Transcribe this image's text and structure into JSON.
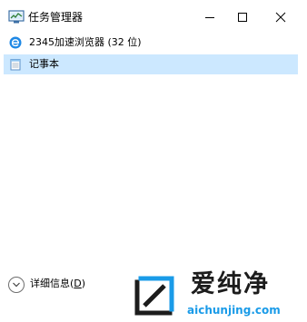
{
  "window": {
    "title": "任务管理器",
    "app_icon": "task-manager-icon"
  },
  "controls": {
    "minimize_icon": "minimize-icon",
    "maximize_icon": "maximize-icon",
    "close_icon": "close-icon"
  },
  "processes": [
    {
      "label": "2345加速浏览器 (32 位)",
      "icon": "browser-e-icon",
      "selected": false
    },
    {
      "label": "记事本",
      "icon": "notepad-icon",
      "selected": true
    }
  ],
  "footer": {
    "details_text": "详细信息(",
    "details_key": "D",
    "details_close": ")",
    "chevron_icon": "chevron-down-icon"
  },
  "watermark": {
    "text": "爱纯净",
    "url": "aichunjing.com"
  },
  "colors": {
    "selection": "#cce8ff",
    "watermark_blue": "#1a9be8"
  }
}
